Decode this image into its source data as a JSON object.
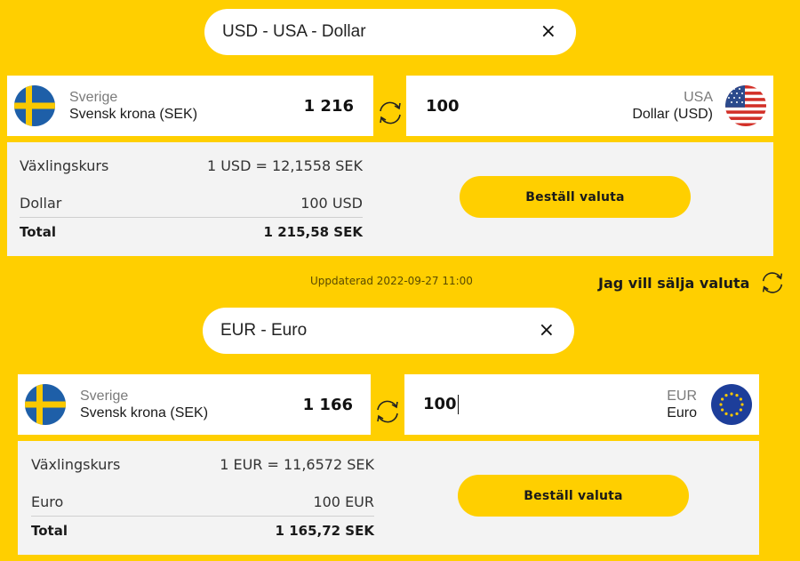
{
  "usd": {
    "search": {
      "value": "USD - USA - Dollar",
      "clear_icon": "×"
    },
    "from": {
      "country": "Sverige",
      "currency": "Svensk krona (SEK)",
      "amount": "1 216",
      "flag": "sweden-flag"
    },
    "to": {
      "amount": "100",
      "country": "USA",
      "currency": "Dollar (USD)",
      "flag": "usa-flag"
    },
    "summary": {
      "rate_label": "Växlingskurs",
      "rate_value": "1 USD = 12,1558 SEK",
      "item_label": "Dollar",
      "item_value": "100 USD",
      "total_label": "Total",
      "total_value": "1 215,58 SEK"
    },
    "order_button": "Beställ valuta"
  },
  "updated": "Uppdaterad 2022-09-27 11:00",
  "sell_link": "Jag vill sälja valuta",
  "eur": {
    "search": {
      "value": "EUR - Euro",
      "clear_icon": "×"
    },
    "from": {
      "country": "Sverige",
      "currency": "Svensk krona (SEK)",
      "amount": "1 166",
      "flag": "sweden-flag"
    },
    "to": {
      "amount": "100",
      "country": "EUR",
      "currency": "Euro",
      "flag": "eu-flag"
    },
    "summary": {
      "rate_label": "Växlingskurs",
      "rate_value": "1 EUR = 11,6572 SEK",
      "item_label": "Euro",
      "item_value": "100 EUR",
      "total_label": "Total",
      "total_value": "1 165,72 SEK"
    },
    "order_button": "Beställ valuta"
  },
  "colors": {
    "brand_yellow": "#FFCF00",
    "panel_grey": "#f3f3f3"
  }
}
